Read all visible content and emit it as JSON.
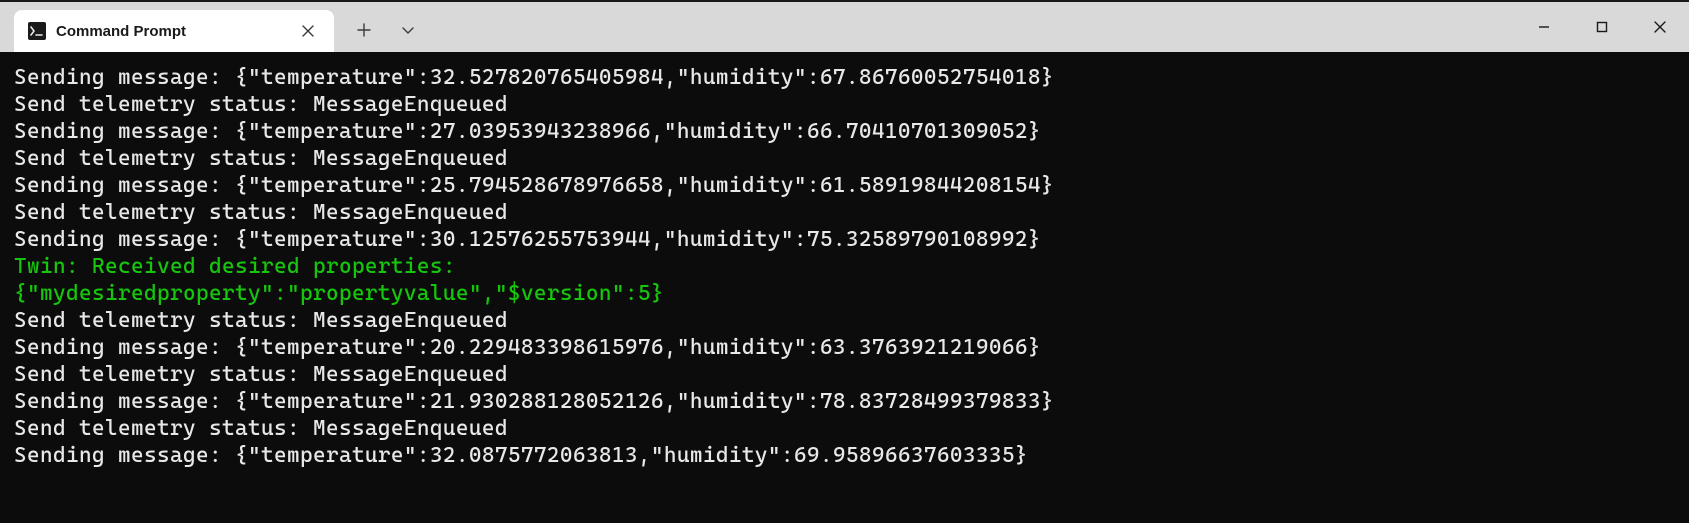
{
  "tab": {
    "title": "Command Prompt"
  },
  "lines": [
    {
      "text": "Sending message: {\"temperature\":32.527820765405984,\"humidity\":67.86760052754018}",
      "cls": ""
    },
    {
      "text": "Send telemetry status: MessageEnqueued",
      "cls": ""
    },
    {
      "text": "Sending message: {\"temperature\":27.03953943238966,\"humidity\":66.70410701309052}",
      "cls": ""
    },
    {
      "text": "Send telemetry status: MessageEnqueued",
      "cls": ""
    },
    {
      "text": "Sending message: {\"temperature\":25.794528678976658,\"humidity\":61.58919844208154}",
      "cls": ""
    },
    {
      "text": "Send telemetry status: MessageEnqueued",
      "cls": ""
    },
    {
      "text": "Sending message: {\"temperature\":30.12576255753944,\"humidity\":75.32589790108992}",
      "cls": ""
    },
    {
      "text": "Twin: Received desired properties:",
      "cls": "green"
    },
    {
      "text": "{\"mydesiredproperty\":\"propertyvalue\",\"$version\":5}",
      "cls": "green"
    },
    {
      "text": "Send telemetry status: MessageEnqueued",
      "cls": ""
    },
    {
      "text": "Sending message: {\"temperature\":20.229483398615976,\"humidity\":63.3763921219066}",
      "cls": ""
    },
    {
      "text": "Send telemetry status: MessageEnqueued",
      "cls": ""
    },
    {
      "text": "Sending message: {\"temperature\":21.930288128052126,\"humidity\":78.83728499379833}",
      "cls": ""
    },
    {
      "text": "Send telemetry status: MessageEnqueued",
      "cls": ""
    },
    {
      "text": "Sending message: {\"temperature\":32.0875772063813,\"humidity\":69.95896637603335}",
      "cls": ""
    }
  ]
}
